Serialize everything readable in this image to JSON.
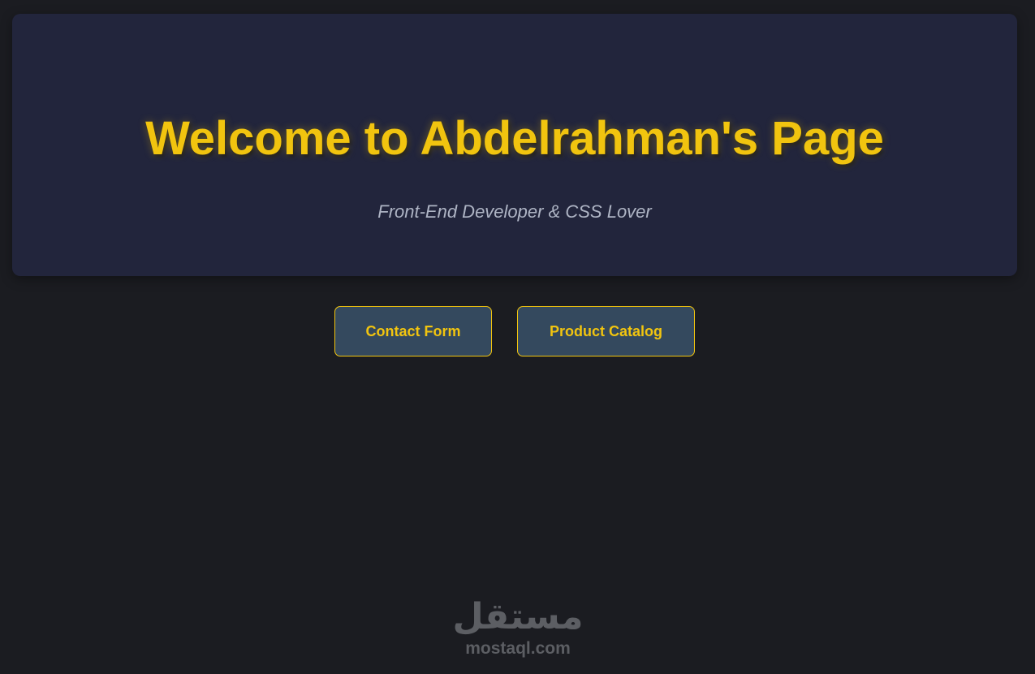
{
  "hero": {
    "title": "Welcome to Abdelrahman's Page",
    "subtitle": "Front-End Developer & CSS Lover"
  },
  "nav": {
    "buttons": [
      {
        "label": "Contact Form"
      },
      {
        "label": "Product Catalog"
      }
    ]
  },
  "watermark": {
    "logo_text": "مستقل",
    "url": "mostaql.com"
  },
  "colors": {
    "background": "#1b1c21",
    "card": "#22253c",
    "accent": "#f1c40f",
    "button_bg": "#34495e",
    "subtitle": "#aeb4c4",
    "watermark": "#5c5e63"
  }
}
